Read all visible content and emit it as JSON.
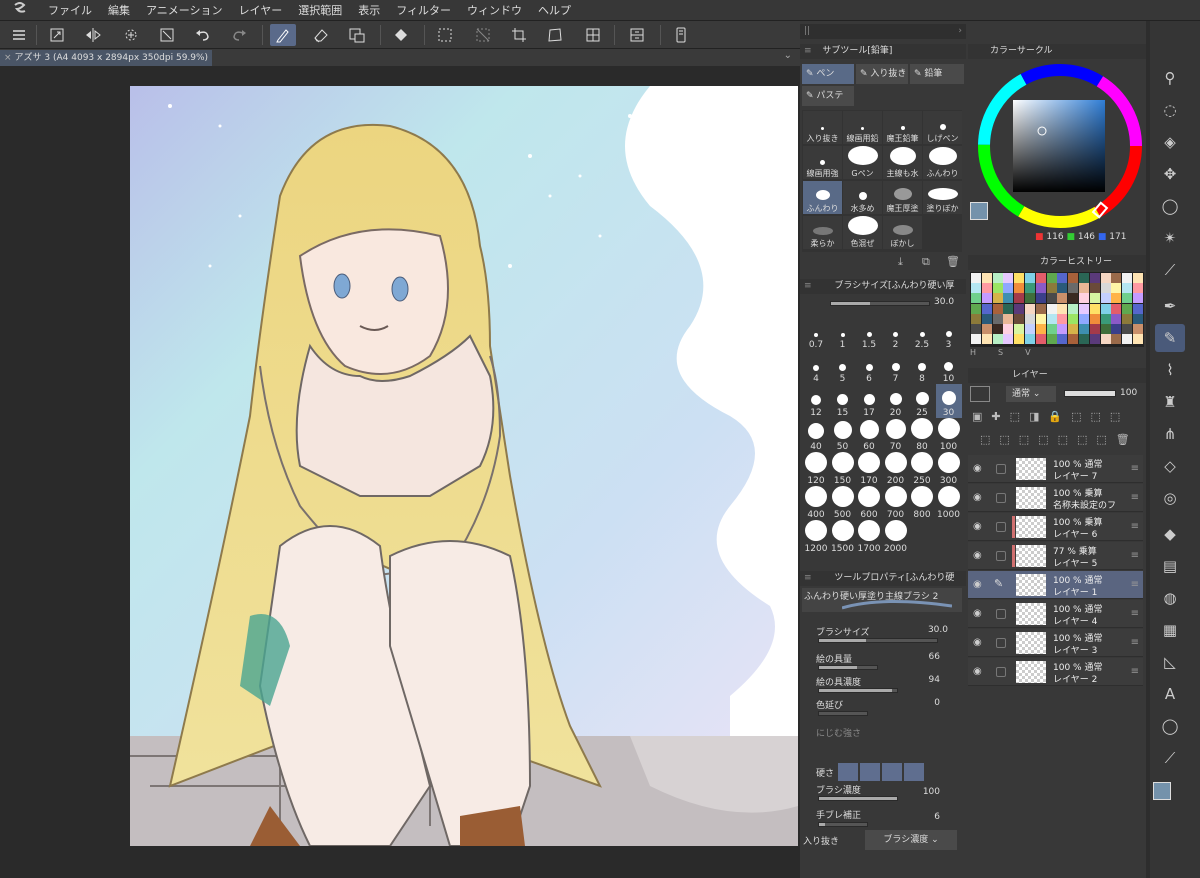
{
  "menu": [
    "ファイル",
    "編集",
    "アニメーション",
    "レイヤー",
    "選択範囲",
    "表示",
    "フィルター",
    "ウィンドウ",
    "ヘルプ"
  ],
  "document": {
    "tab_label": "アズサ 3 (A4 4093 x 2894px 350dpi 59.9%)"
  },
  "subtool": {
    "title": "サブツール[鉛筆]",
    "groups": [
      "ペン",
      "入り抜き",
      "鉛筆",
      "パステ"
    ],
    "brushes": [
      "入り抜き",
      "線画用鉛",
      "魔王鉛筆",
      "しげペン",
      "線画用強",
      "Gペン",
      "主線も水",
      "ふんわり",
      "ふんわり",
      "水多め",
      "魔王厚塗",
      "塗りぼか",
      "柔らか",
      "色混ぜ",
      "ぼかし"
    ]
  },
  "brush_size": {
    "title": "ブラシサイズ[ふんわり硬い厚",
    "value": "30.0",
    "sizes": [
      "0.7",
      "1",
      "1.5",
      "2",
      "2.5",
      "3",
      "4",
      "5",
      "6",
      "7",
      "8",
      "10",
      "12",
      "15",
      "17",
      "20",
      "25",
      "30",
      "40",
      "50",
      "60",
      "70",
      "80",
      "100",
      "120",
      "150",
      "170",
      "200",
      "250",
      "300",
      "400",
      "500",
      "600",
      "700",
      "800",
      "1000",
      "1200",
      "1500",
      "1700",
      "2000"
    ]
  },
  "tool_property": {
    "title": "ツールプロパティ[ふんわり硬",
    "brush_name": "ふんわり硬い厚塗り主線ブラシ 2",
    "brush_size_label": "ブラシサイズ",
    "brush_size_value": "30.0",
    "paint_amount_label": "絵の具量",
    "paint_amount_value": "66",
    "paint_density_label": "絵の具濃度",
    "paint_density_value": "94",
    "color_stretch_label": "色延び",
    "color_stretch_value": "0",
    "blur_label": "にじむ強さ",
    "hardness_label": "硬さ",
    "brush_density_label": "ブラシ濃度",
    "brush_density_value": "100",
    "stabilization_label": "手ブレ補正",
    "stabilization_value": "6",
    "taper_label": "入り抜き",
    "taper_select": "ブラシ濃度"
  },
  "color_circle": {
    "title": "カラーサークル",
    "r": "116",
    "g": "146",
    "b": "171",
    "current_color": "#7492ab"
  },
  "color_history": {
    "title": "カラーヒストリー",
    "tabs": [
      "H",
      "S",
      "V"
    ]
  },
  "layers": {
    "title": "レイヤー",
    "blend_mode": "通常",
    "opacity": "100",
    "items": [
      {
        "mode": "100 % 通常",
        "name": "レイヤー 7"
      },
      {
        "mode": "100 % 乗算",
        "name": "名称未設定のフ"
      },
      {
        "mode": "100 % 乗算",
        "name": "レイヤー 6"
      },
      {
        "mode": "77 % 乗算",
        "name": "レイヤー 5"
      },
      {
        "mode": "100 % 通常",
        "name": "レイヤー 1"
      },
      {
        "mode": "100 % 通常",
        "name": "レイヤー 4"
      },
      {
        "mode": "100 % 通常",
        "name": "レイヤー 3"
      },
      {
        "mode": "100 % 通常",
        "name": "レイヤー 2"
      }
    ]
  }
}
